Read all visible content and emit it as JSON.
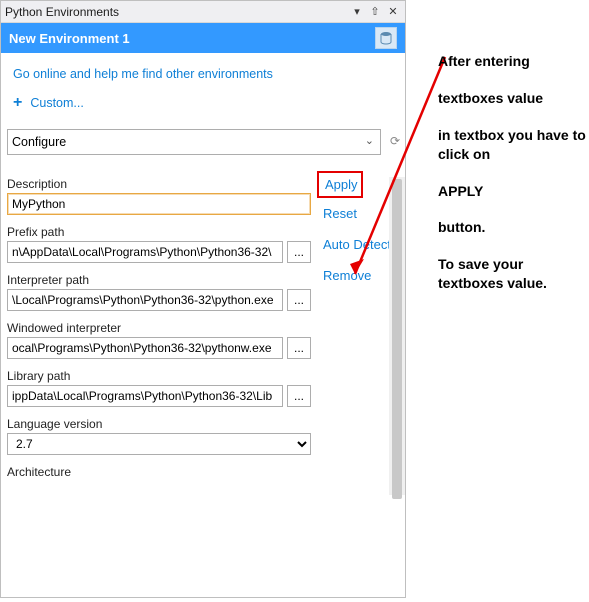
{
  "window": {
    "title": "Python Environments"
  },
  "header": {
    "env_name": "New Environment 1"
  },
  "links": {
    "online_help": "Go online and help me find other environments",
    "custom": "Custom..."
  },
  "dropdown": {
    "selected": "Configure"
  },
  "actions": {
    "apply": "Apply",
    "reset": "Reset",
    "auto_detect": "Auto Detect",
    "remove": "Remove"
  },
  "fields": {
    "description": {
      "label": "Description",
      "value": "MyPython"
    },
    "prefix": {
      "label": "Prefix path",
      "value": "n\\AppData\\Local\\Programs\\Python\\Python36-32\\"
    },
    "interpreter": {
      "label": "Interpreter path",
      "value": "\\Local\\Programs\\Python\\Python36-32\\python.exe"
    },
    "windowed": {
      "label": "Windowed interpreter",
      "value": "ocal\\Programs\\Python\\Python36-32\\pythonw.exe"
    },
    "library": {
      "label": "Library path",
      "value": "ippData\\Local\\Programs\\Python\\Python36-32\\Lib"
    },
    "language": {
      "label": "Language version",
      "value": "2.7"
    },
    "architecture": {
      "label": "Architecture"
    }
  },
  "browse_label": "...",
  "annotation": {
    "l1": "After entering",
    "l2": "textboxes value",
    "l3": "in textbox you have to click on",
    "l4": "APPLY",
    "l5": "button.",
    "l6": "To save your textboxes value."
  }
}
